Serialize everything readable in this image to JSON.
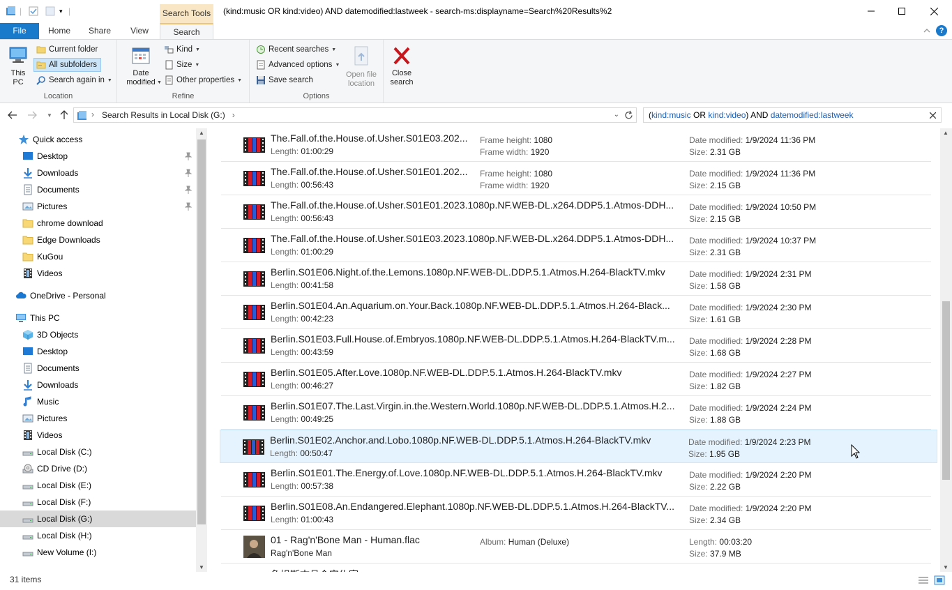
{
  "window": {
    "title": "(kind:music OR kind:video) AND datemodified:lastweek - search-ms:displayname=Search%20Results%2",
    "context_tab": "Search Tools"
  },
  "tabs": {
    "file": "File",
    "home": "Home",
    "share": "Share",
    "view": "View",
    "search": "Search"
  },
  "ribbon": {
    "location": {
      "this_pc": "This\nPC",
      "current_folder": "Current folder",
      "all_subfolders": "All subfolders",
      "search_again_in": "Search again in",
      "label": "Location"
    },
    "refine": {
      "date_modified": "Date\nmodified",
      "kind": "Kind",
      "size": "Size",
      "other_properties": "Other properties",
      "label": "Refine"
    },
    "options": {
      "recent_searches": "Recent searches",
      "advanced_options": "Advanced options",
      "save_search": "Save search",
      "open_file_location": "Open file\nlocation",
      "label": "Options"
    },
    "close_search": "Close\nsearch"
  },
  "address": {
    "path": "Search Results in Local Disk (G:)",
    "search_query": {
      "open1": "(",
      "kind1": "kind:music",
      "or": " OR ",
      "kind2": "kind:video",
      "and": ") AND ",
      "date": "datemodified:lastweek"
    }
  },
  "nav": {
    "items": [
      {
        "label": "Quick access",
        "icon": "star-icon"
      },
      {
        "label": "Desktop",
        "icon": "desktop-icon",
        "pinned": true
      },
      {
        "label": "Downloads",
        "icon": "download-icon",
        "pinned": true
      },
      {
        "label": "Documents",
        "icon": "documents-icon",
        "pinned": true
      },
      {
        "label": "Pictures",
        "icon": "pictures-icon",
        "pinned": true
      },
      {
        "label": "chrome download",
        "icon": "folder-icon"
      },
      {
        "label": "Edge Downloads",
        "icon": "folder-icon"
      },
      {
        "label": "KuGou",
        "icon": "folder-icon"
      },
      {
        "label": "Videos",
        "icon": "videos-icon"
      },
      {
        "label": "OneDrive - Personal",
        "icon": "cloud-icon"
      },
      {
        "label": "This PC",
        "icon": "computer-icon"
      },
      {
        "label": "3D Objects",
        "icon": "cube-icon"
      },
      {
        "label": "Desktop",
        "icon": "desktop-icon"
      },
      {
        "label": "Documents",
        "icon": "documents-icon"
      },
      {
        "label": "Downloads",
        "icon": "download-icon"
      },
      {
        "label": "Music",
        "icon": "music-icon"
      },
      {
        "label": "Pictures",
        "icon": "pictures-icon"
      },
      {
        "label": "Videos",
        "icon": "videos-icon"
      },
      {
        "label": "Local Disk (C:)",
        "icon": "drive-icon"
      },
      {
        "label": "CD Drive (D:)",
        "icon": "cd-drive-icon"
      },
      {
        "label": "Local Disk (E:)",
        "icon": "drive-icon"
      },
      {
        "label": "Local Disk (F:)",
        "icon": "drive-icon"
      },
      {
        "label": "Local Disk (G:)",
        "icon": "drive-icon",
        "selected": true
      },
      {
        "label": "Local Disk (H:)",
        "icon": "drive-icon"
      },
      {
        "label": "New Volume (I:)",
        "icon": "drive-icon"
      }
    ]
  },
  "labels": {
    "length": "Length:",
    "frame_height": "Frame height:",
    "frame_width": "Frame width:",
    "date_modified": "Date modified:",
    "size": "Size:",
    "album": "Album:"
  },
  "files": [
    {
      "name": "The.Fall.of.the.House.of.Usher.S01E03.202...",
      "length": "01:00:29",
      "frame_height": "1080",
      "frame_width": "1920",
      "date": "1/9/2024 11:36 PM",
      "size": "2.31 GB"
    },
    {
      "name": "The.Fall.of.the.House.of.Usher.S01E01.202...",
      "length": "00:56:43",
      "frame_height": "1080",
      "frame_width": "1920",
      "date": "1/9/2024 11:36 PM",
      "size": "2.15 GB"
    },
    {
      "name": "The.Fall.of.the.House.of.Usher.S01E01.2023.1080p.NF.WEB-DL.x264.DDP5.1.Atmos-DDH...",
      "length": "00:56:43",
      "date": "1/9/2024 10:50 PM",
      "size": "2.15 GB"
    },
    {
      "name": "The.Fall.of.the.House.of.Usher.S01E03.2023.1080p.NF.WEB-DL.x264.DDP5.1.Atmos-DDH...",
      "length": "01:00:29",
      "date": "1/9/2024 10:37 PM",
      "size": "2.31 GB"
    },
    {
      "name": "Berlin.S01E06.Night.of.the.Lemons.1080p.NF.WEB-DL.DDP.5.1.Atmos.H.264-BlackTV.mkv",
      "length": "00:41:58",
      "date": "1/9/2024 2:31 PM",
      "size": "1.58 GB"
    },
    {
      "name": "Berlin.S01E04.An.Aquarium.on.Your.Back.1080p.NF.WEB-DL.DDP.5.1.Atmos.H.264-Black...",
      "length": "00:42:23",
      "date": "1/9/2024 2:30 PM",
      "size": "1.61 GB"
    },
    {
      "name": "Berlin.S01E03.Full.House.of.Embryos.1080p.NF.WEB-DL.DDP.5.1.Atmos.H.264-BlackTV.m...",
      "length": "00:43:59",
      "date": "1/9/2024 2:28 PM",
      "size": "1.68 GB"
    },
    {
      "name": "Berlin.S01E05.After.Love.1080p.NF.WEB-DL.DDP.5.1.Atmos.H.264-BlackTV.mkv",
      "length": "00:46:27",
      "date": "1/9/2024 2:27 PM",
      "size": "1.82 GB"
    },
    {
      "name": "Berlin.S01E07.The.Last.Virgin.in.the.Western.World.1080p.NF.WEB-DL.DDP.5.1.Atmos.H.2...",
      "length": "00:49:25",
      "date": "1/9/2024 2:24 PM",
      "size": "1.88 GB"
    },
    {
      "name": "Berlin.S01E02.Anchor.and.Lobo.1080p.NF.WEB-DL.DDP.5.1.Atmos.H.264-BlackTV.mkv",
      "length": "00:50:47",
      "date": "1/9/2024 2:23 PM",
      "size": "1.95 GB",
      "selected": true
    },
    {
      "name": "Berlin.S01E01.The.Energy.of.Love.1080p.NF.WEB-DL.DDP.5.1.Atmos.H.264-BlackTV.mkv",
      "length": "00:57:38",
      "date": "1/9/2024 2:20 PM",
      "size": "2.22 GB"
    },
    {
      "name": "Berlin.S01E08.An.Endangered.Elephant.1080p.NF.WEB-DL.DDP.5.1.Atmos.H.264-BlackTV...",
      "length": "01:00:43",
      "date": "1/9/2024 2:20 PM",
      "size": "2.34 GB"
    }
  ],
  "music_file": {
    "name": "01 - Rag'n'Bone Man - Human.flac",
    "artist": "Rag'n'Bone Man",
    "album": "Human (Deluxe)",
    "length": "00:03:20",
    "size": "37.9 MB"
  },
  "partial_row": {
    "name": "鱼姐斯古县会突佐室"
  },
  "status": {
    "count": "31 items"
  }
}
